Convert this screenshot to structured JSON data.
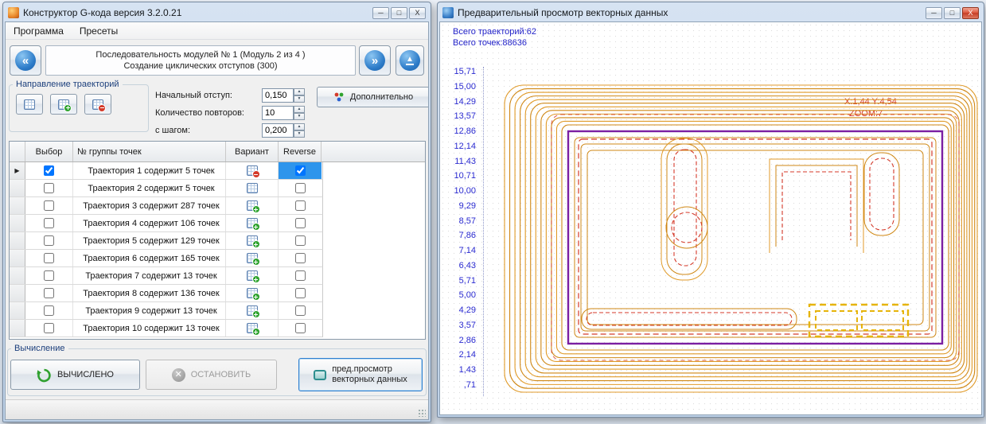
{
  "left_window": {
    "title": "Конструктор G-кода версия 3.2.0.21",
    "window_buttons": {
      "minimize": "─",
      "maximize": "□",
      "close": "Х"
    },
    "menu": {
      "program": "Программа",
      "presets": "Пресеты"
    },
    "nav": {
      "sequence_line1": "Последовательность модулей № 1 (Модуль 2 из 4 )",
      "sequence_line2": "Создание циклических отступов (300)",
      "prev_glyph": "«",
      "next_glyph": "»"
    },
    "direction_group_label": "Направление траекторий",
    "params": {
      "initial_offset_label": "Начальный отступ:",
      "initial_offset_value": "0,150",
      "repeats_label": "Количество повторов:",
      "repeats_value": "10",
      "step_label": "с шагом:",
      "step_value": "0,200"
    },
    "additional_button_label": "Дополнительно",
    "table": {
      "headers": {
        "select": "Выбор",
        "group": "№ группы точек",
        "variant": "Вариант",
        "reverse": "Reverse"
      },
      "rows": [
        {
          "selected": true,
          "label": "Траектория 1 содержит 5 точек",
          "variant_icon": "calculator-red",
          "reverse": true
        },
        {
          "selected": false,
          "label": "Траектория 2 содержит 5 точек",
          "variant_icon": "calculator",
          "reverse": false
        },
        {
          "selected": false,
          "label": "Траектория 3 содержит 287 точек",
          "variant_icon": "calculator-plus",
          "reverse": false
        },
        {
          "selected": false,
          "label": "Траектория 4 содержит 106 точек",
          "variant_icon": "calculator-plus",
          "reverse": false
        },
        {
          "selected": false,
          "label": "Траектория 5 содержит 129 точек",
          "variant_icon": "calculator-plus",
          "reverse": false
        },
        {
          "selected": false,
          "label": "Траектория 6 содержит 165 точек",
          "variant_icon": "calculator-plus",
          "reverse": false
        },
        {
          "selected": false,
          "label": "Траектория 7 содержит 13 точек",
          "variant_icon": "calculator-plus",
          "reverse": false
        },
        {
          "selected": false,
          "label": "Траектория 8 содержит 136 точек",
          "variant_icon": "calculator-plus",
          "reverse": false
        },
        {
          "selected": false,
          "label": "Траектория 9 содержит 13 точек",
          "variant_icon": "calculator-plus",
          "reverse": false
        },
        {
          "selected": false,
          "label": "Траектория 10 содержит 13 точек",
          "variant_icon": "calculator-plus",
          "reverse": false
        }
      ]
    },
    "calculation_group_label": "Вычисление",
    "buttons": {
      "calculated": "ВЫЧИСЛЕНО",
      "stop": "ОСТАНОВИТЬ",
      "preview_line1": "пред.просмотр",
      "preview_line2": "векторных данных"
    }
  },
  "right_window": {
    "title": "Предварительный просмотр векторных данных",
    "window_buttons": {
      "minimize": "─",
      "maximize": "□",
      "close": "X"
    },
    "stats": {
      "trajectories": "Всего траекторий:62",
      "points": "Всего точек:88636"
    },
    "overlay": {
      "cursor": "X:1,44 Y:4,54",
      "zoom": "ZOOM:7"
    },
    "y_axis_labels": [
      "15,71",
      "15,00",
      "14,29",
      "13,57",
      "12,86",
      "12,14",
      "11,43",
      "10,71",
      "10,00",
      "9,29",
      "8,57",
      "7,86",
      "7,14",
      "6,43",
      "5,71",
      "5,00",
      "4,29",
      "3,57",
      "2,86",
      "2,14",
      "1,43",
      ",71"
    ],
    "colors": {
      "contour_dark": "#cf8714",
      "contour_light": "#e09a28",
      "board_outline": "#7b1fa2",
      "dashed_red": "#d43a2a",
      "highlight_gold": "#e6b40a",
      "text_blue": "#2222c8",
      "text_red": "#d43a2a"
    }
  }
}
